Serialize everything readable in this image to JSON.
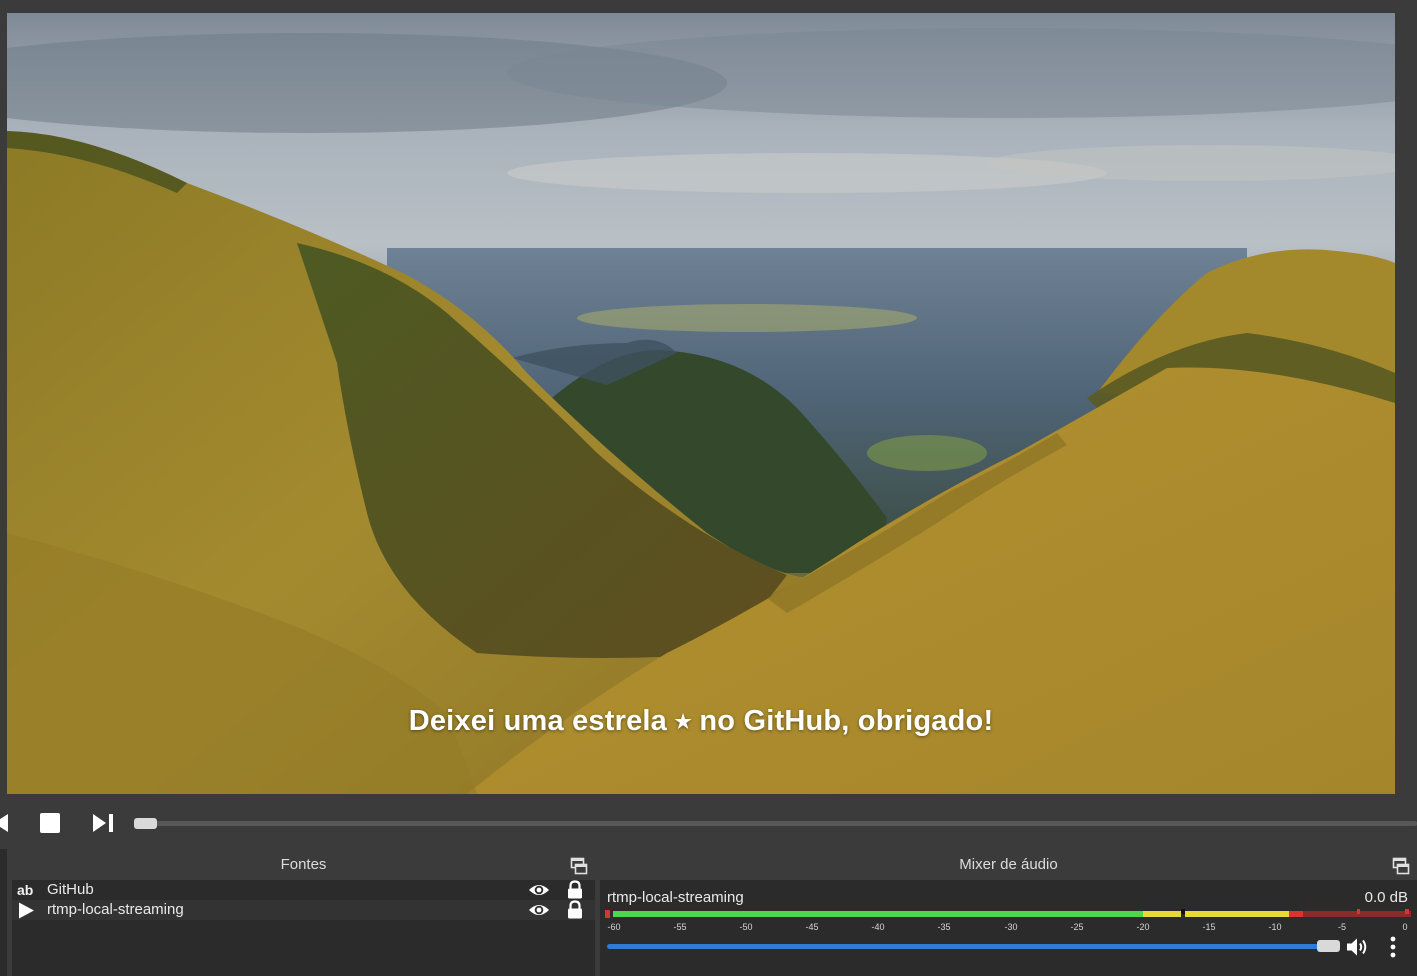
{
  "preview": {
    "overlay_text": "Deixei uma estrela ⭒ no GitHub, obrigado!"
  },
  "transport": {
    "buttons": [
      "previous-icon",
      "stop-icon",
      "next-icon"
    ],
    "seek_progress": 0.0
  },
  "sources_dock": {
    "title": "Fontes",
    "items": [
      {
        "type_icon": "text-source-icon",
        "type_glyph": "ab",
        "name": "GitHub",
        "visible": true,
        "locked": true
      },
      {
        "type_icon": "media-source-icon",
        "name": "rtmp-local-streaming",
        "visible": true,
        "locked": true
      }
    ]
  },
  "mixer_dock": {
    "title": "Mixer de áudio",
    "channel": {
      "name": "rtmp-local-streaming",
      "level": "0.0 dB",
      "volume_fraction": 1.0,
      "scale_ticks": [
        "-60",
        "-55",
        "-50",
        "-45",
        "-40",
        "-35",
        "-30",
        "-25",
        "-20",
        "-15",
        "-10",
        "-5",
        "0"
      ]
    }
  },
  "colors": {
    "meter_green": "#4cd84c",
    "meter_yellow": "#e8d83a",
    "meter_red": "#d93434",
    "volume_blue": "#2f7bd6"
  }
}
